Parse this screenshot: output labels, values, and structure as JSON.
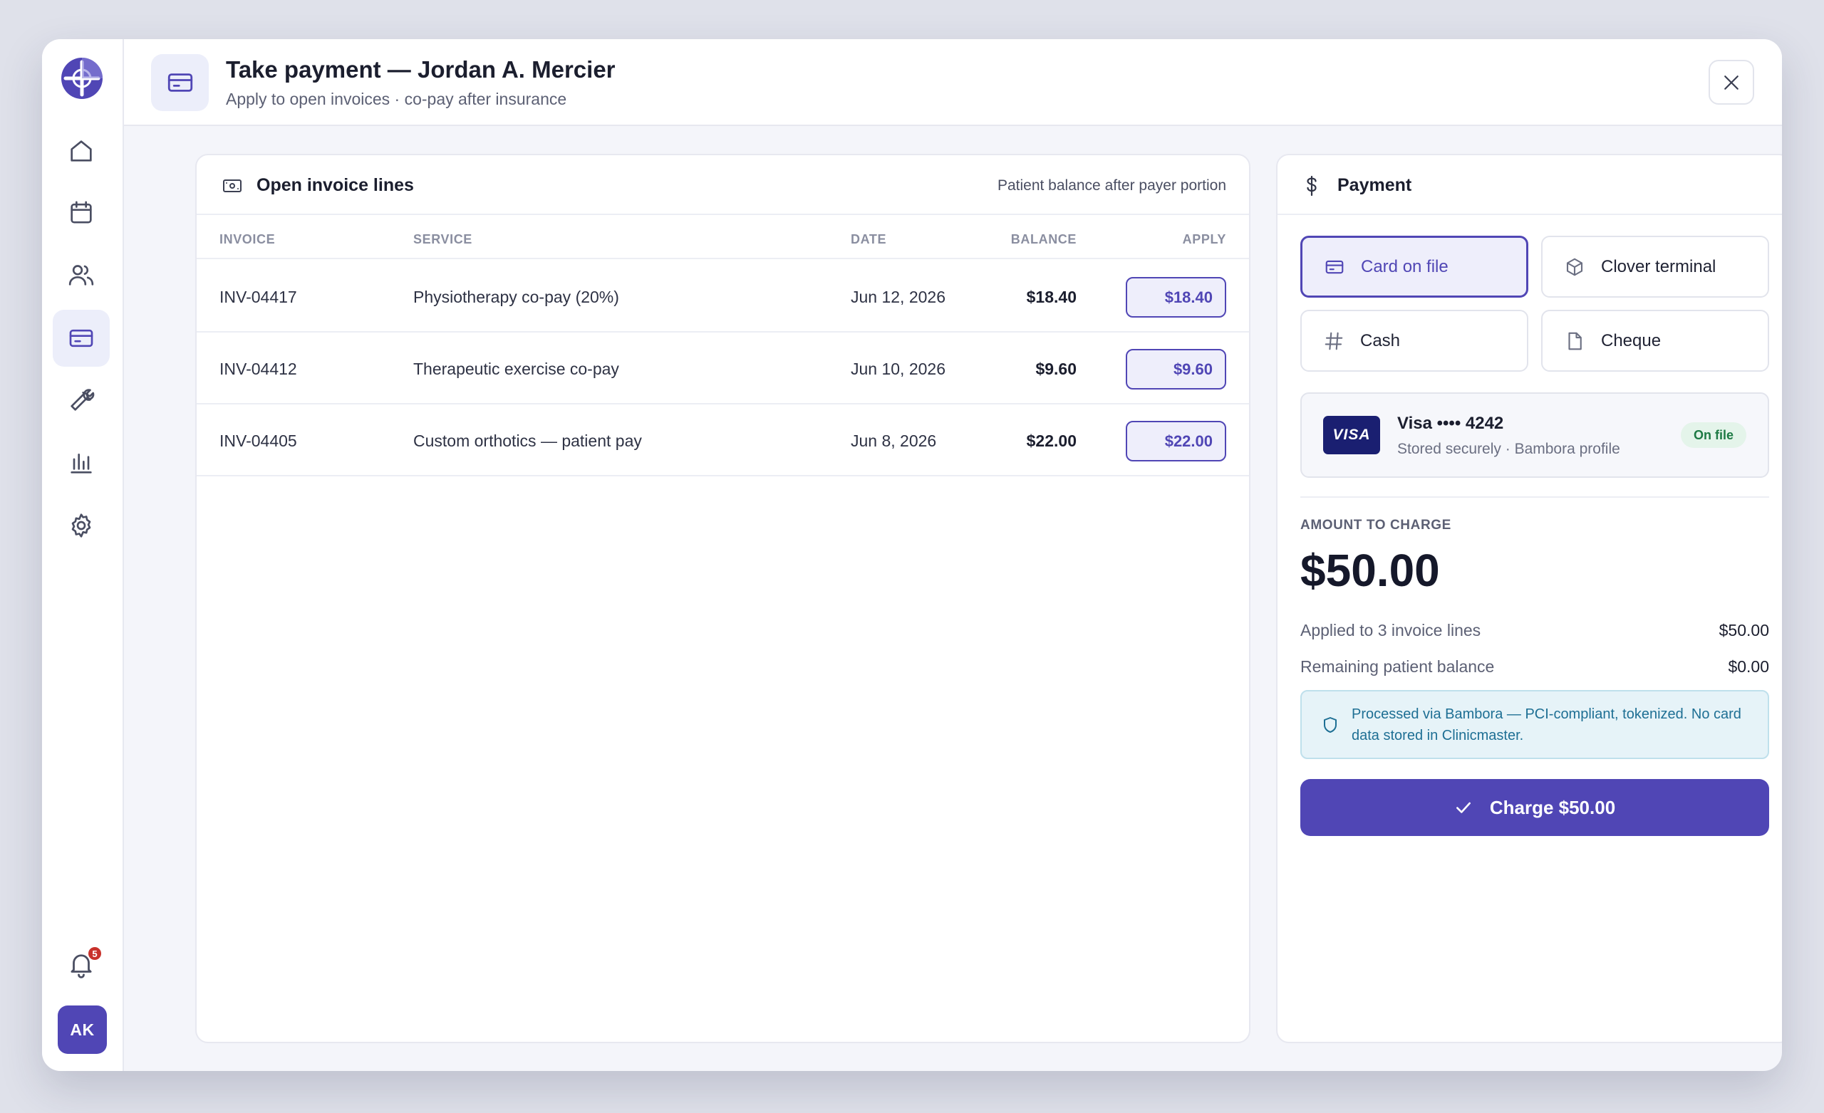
{
  "header": {
    "title": "Take payment — Jordan A. Mercier",
    "subtitle": "Apply to open invoices · co-pay after insurance"
  },
  "sidebar": {
    "items": [
      {
        "icon": "home-icon"
      },
      {
        "icon": "calendar-icon"
      },
      {
        "icon": "users-icon"
      },
      {
        "icon": "credit-card-icon",
        "active": true
      },
      {
        "icon": "wrench-icon"
      },
      {
        "icon": "bar-chart-icon"
      },
      {
        "icon": "gear-icon"
      }
    ],
    "notifications_count": "5",
    "user_initials": "AK"
  },
  "invoices": {
    "title": "Open invoice lines",
    "note": "Patient balance after payer portion",
    "columns": {
      "invoice": "INVOICE",
      "service": "SERVICE",
      "date": "DATE",
      "balance": "BALANCE",
      "apply": "APPLY"
    },
    "rows": [
      {
        "invoice": "INV-04417",
        "service": "Physiotherapy co-pay (20%)",
        "date": "Jun 12, 2026",
        "balance": "$18.40",
        "apply": "$18.40"
      },
      {
        "invoice": "INV-04412",
        "service": "Therapeutic exercise co-pay",
        "date": "Jun 10, 2026",
        "balance": "$9.60",
        "apply": "$9.60"
      },
      {
        "invoice": "INV-04405",
        "service": "Custom orthotics — patient pay",
        "date": "Jun 8, 2026",
        "balance": "$22.00",
        "apply": "$22.00"
      }
    ]
  },
  "payment": {
    "title": "Payment",
    "methods": [
      {
        "label": "Card on file",
        "icon": "credit-card-icon",
        "selected": true
      },
      {
        "label": "Clover terminal",
        "icon": "box-icon",
        "selected": false
      },
      {
        "label": "Cash",
        "icon": "hash-icon",
        "selected": false
      },
      {
        "label": "Cheque",
        "icon": "document-icon",
        "selected": false
      }
    ],
    "card": {
      "brand": "VISA",
      "name": "Visa •••• 4242",
      "detail": "Stored securely · Bambora profile",
      "badge": "On file"
    },
    "amount_label": "AMOUNT TO CHARGE",
    "amount": "$50.00",
    "summary": [
      {
        "label": "Applied to 3 invoice lines",
        "value": "$50.00"
      },
      {
        "label": "Remaining patient balance",
        "value": "$0.00"
      }
    ],
    "notice": "Processed via Bambora — PCI-compliant, tokenized. No card data stored in Clinicmaster.",
    "charge_label": "Charge $50.00"
  },
  "colors": {
    "accent": "#5046b5",
    "success": "#1d7a44",
    "info": "#1e6f94",
    "badge": "#c8312b"
  }
}
